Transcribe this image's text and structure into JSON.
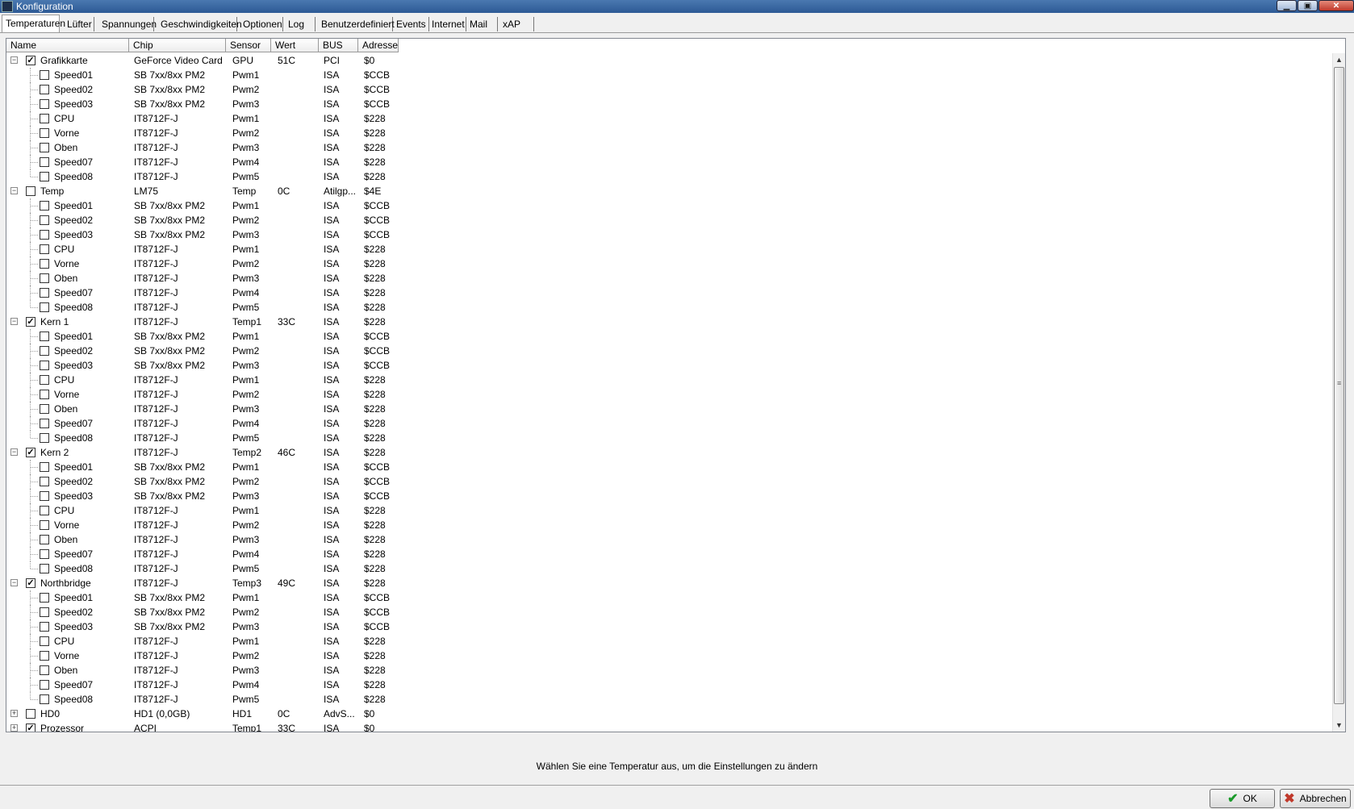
{
  "window": {
    "title": "Konfiguration",
    "minimize": "▁",
    "maximize": "▣",
    "close": "✕"
  },
  "tabs": [
    "Temperaturen",
    "Lüfter",
    "Spannungen",
    "Geschwindigkeiten",
    "Optionen",
    "Log",
    "Benutzerdefiniert",
    "Events",
    "Internet",
    "Mail",
    "xAP"
  ],
  "active_tab": "Temperaturen",
  "columns": [
    "Name",
    "Chip",
    "Sensor",
    "Wert",
    "BUS",
    "Adresse"
  ],
  "groups": [
    {
      "name": "Grafikkarte",
      "chip": "GeForce Video Card",
      "sensor": "GPU",
      "wert": "51C",
      "bus": "PCI",
      "adresse": "$0",
      "checked": true,
      "expanded": true
    },
    {
      "name": "Temp",
      "chip": "LM75",
      "sensor": "Temp",
      "wert": "0C",
      "bus": "Atilgp...",
      "adresse": "$4E",
      "checked": false,
      "expanded": true
    },
    {
      "name": "Kern 1",
      "chip": "IT8712F-J",
      "sensor": "Temp1",
      "wert": "33C",
      "bus": "ISA",
      "adresse": "$228",
      "checked": true,
      "expanded": true
    },
    {
      "name": "Kern 2",
      "chip": "IT8712F-J",
      "sensor": "Temp2",
      "wert": "46C",
      "bus": "ISA",
      "adresse": "$228",
      "checked": true,
      "expanded": true
    },
    {
      "name": "Northbridge",
      "chip": "IT8712F-J",
      "sensor": "Temp3",
      "wert": "49C",
      "bus": "ISA",
      "adresse": "$228",
      "checked": true,
      "expanded": true
    },
    {
      "name": "HD0",
      "chip": "HD1 (0,0GB)",
      "sensor": "HD1",
      "wert": "0C",
      "bus": "AdvS...",
      "adresse": "$0",
      "checked": false,
      "expanded": false
    },
    {
      "name": "Prozessor",
      "chip": "ACPI",
      "sensor": "Temp1",
      "wert": "33C",
      "bus": "ISA",
      "adresse": "$0",
      "checked": true,
      "expanded": false
    }
  ],
  "fans": [
    {
      "name": "Speed01",
      "chip": "SB 7xx/8xx PM2",
      "sensor": "Pwm1",
      "wert": "",
      "bus": "ISA",
      "adresse": "$CCB",
      "checked": false
    },
    {
      "name": "Speed02",
      "chip": "SB 7xx/8xx PM2",
      "sensor": "Pwm2",
      "wert": "",
      "bus": "ISA",
      "adresse": "$CCB",
      "checked": false
    },
    {
      "name": "Speed03",
      "chip": "SB 7xx/8xx PM2",
      "sensor": "Pwm3",
      "wert": "",
      "bus": "ISA",
      "adresse": "$CCB",
      "checked": false
    },
    {
      "name": "CPU",
      "chip": "IT8712F-J",
      "sensor": "Pwm1",
      "wert": "",
      "bus": "ISA",
      "adresse": "$228",
      "checked": false
    },
    {
      "name": "Vorne",
      "chip": "IT8712F-J",
      "sensor": "Pwm2",
      "wert": "",
      "bus": "ISA",
      "adresse": "$228",
      "checked": false
    },
    {
      "name": "Oben",
      "chip": "IT8712F-J",
      "sensor": "Pwm3",
      "wert": "",
      "bus": "ISA",
      "adresse": "$228",
      "checked": false
    },
    {
      "name": "Speed07",
      "chip": "IT8712F-J",
      "sensor": "Pwm4",
      "wert": "",
      "bus": "ISA",
      "adresse": "$228",
      "checked": false
    },
    {
      "name": "Speed08",
      "chip": "IT8712F-J",
      "sensor": "Pwm5",
      "wert": "",
      "bus": "ISA",
      "adresse": "$228",
      "checked": false
    }
  ],
  "status_text": "Wählen Sie eine Temperatur aus, um die Einstellungen zu ändern",
  "buttons": {
    "ok": "OK",
    "cancel": "Abbrechen"
  },
  "colors": {
    "ok_icon": "#1a9a2a",
    "cancel_icon": "#c0392b",
    "titlebar": "#2d5a95"
  }
}
